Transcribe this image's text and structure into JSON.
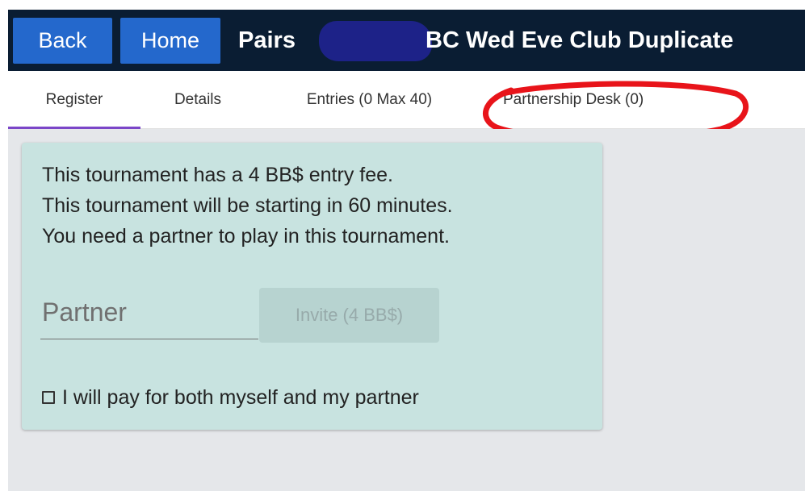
{
  "header": {
    "back_label": "Back",
    "home_label": "Home",
    "title": "Pairs",
    "club_name": "BC Wed Eve Club Duplicate",
    "colors": {
      "header_bg": "#0a1d33",
      "button_bg": "#2468cc",
      "redaction": "#1d2288"
    }
  },
  "tabs": [
    {
      "label": "Register",
      "active": true
    },
    {
      "label": "Details",
      "active": false
    },
    {
      "label": "Entries (0 Max 40)",
      "active": false
    },
    {
      "label": "Partnership Desk (0)",
      "active": false
    }
  ],
  "annotation": {
    "color": "#e8141a",
    "shape": "ellipse"
  },
  "register": {
    "info_lines": [
      "This tournament has a 4 BB$ entry fee.",
      "This tournament will be starting in 60 minutes.",
      "You need a partner to play in this tournament."
    ],
    "partner_placeholder": "Partner",
    "partner_value": "",
    "invite_label": "Invite (4 BB$)",
    "invite_enabled": false,
    "pay_both_label": "I will pay for both myself and my partner",
    "pay_both_checked": false,
    "colors": {
      "card_bg": "#c8e3e0",
      "accent": "#7b46c8"
    }
  }
}
